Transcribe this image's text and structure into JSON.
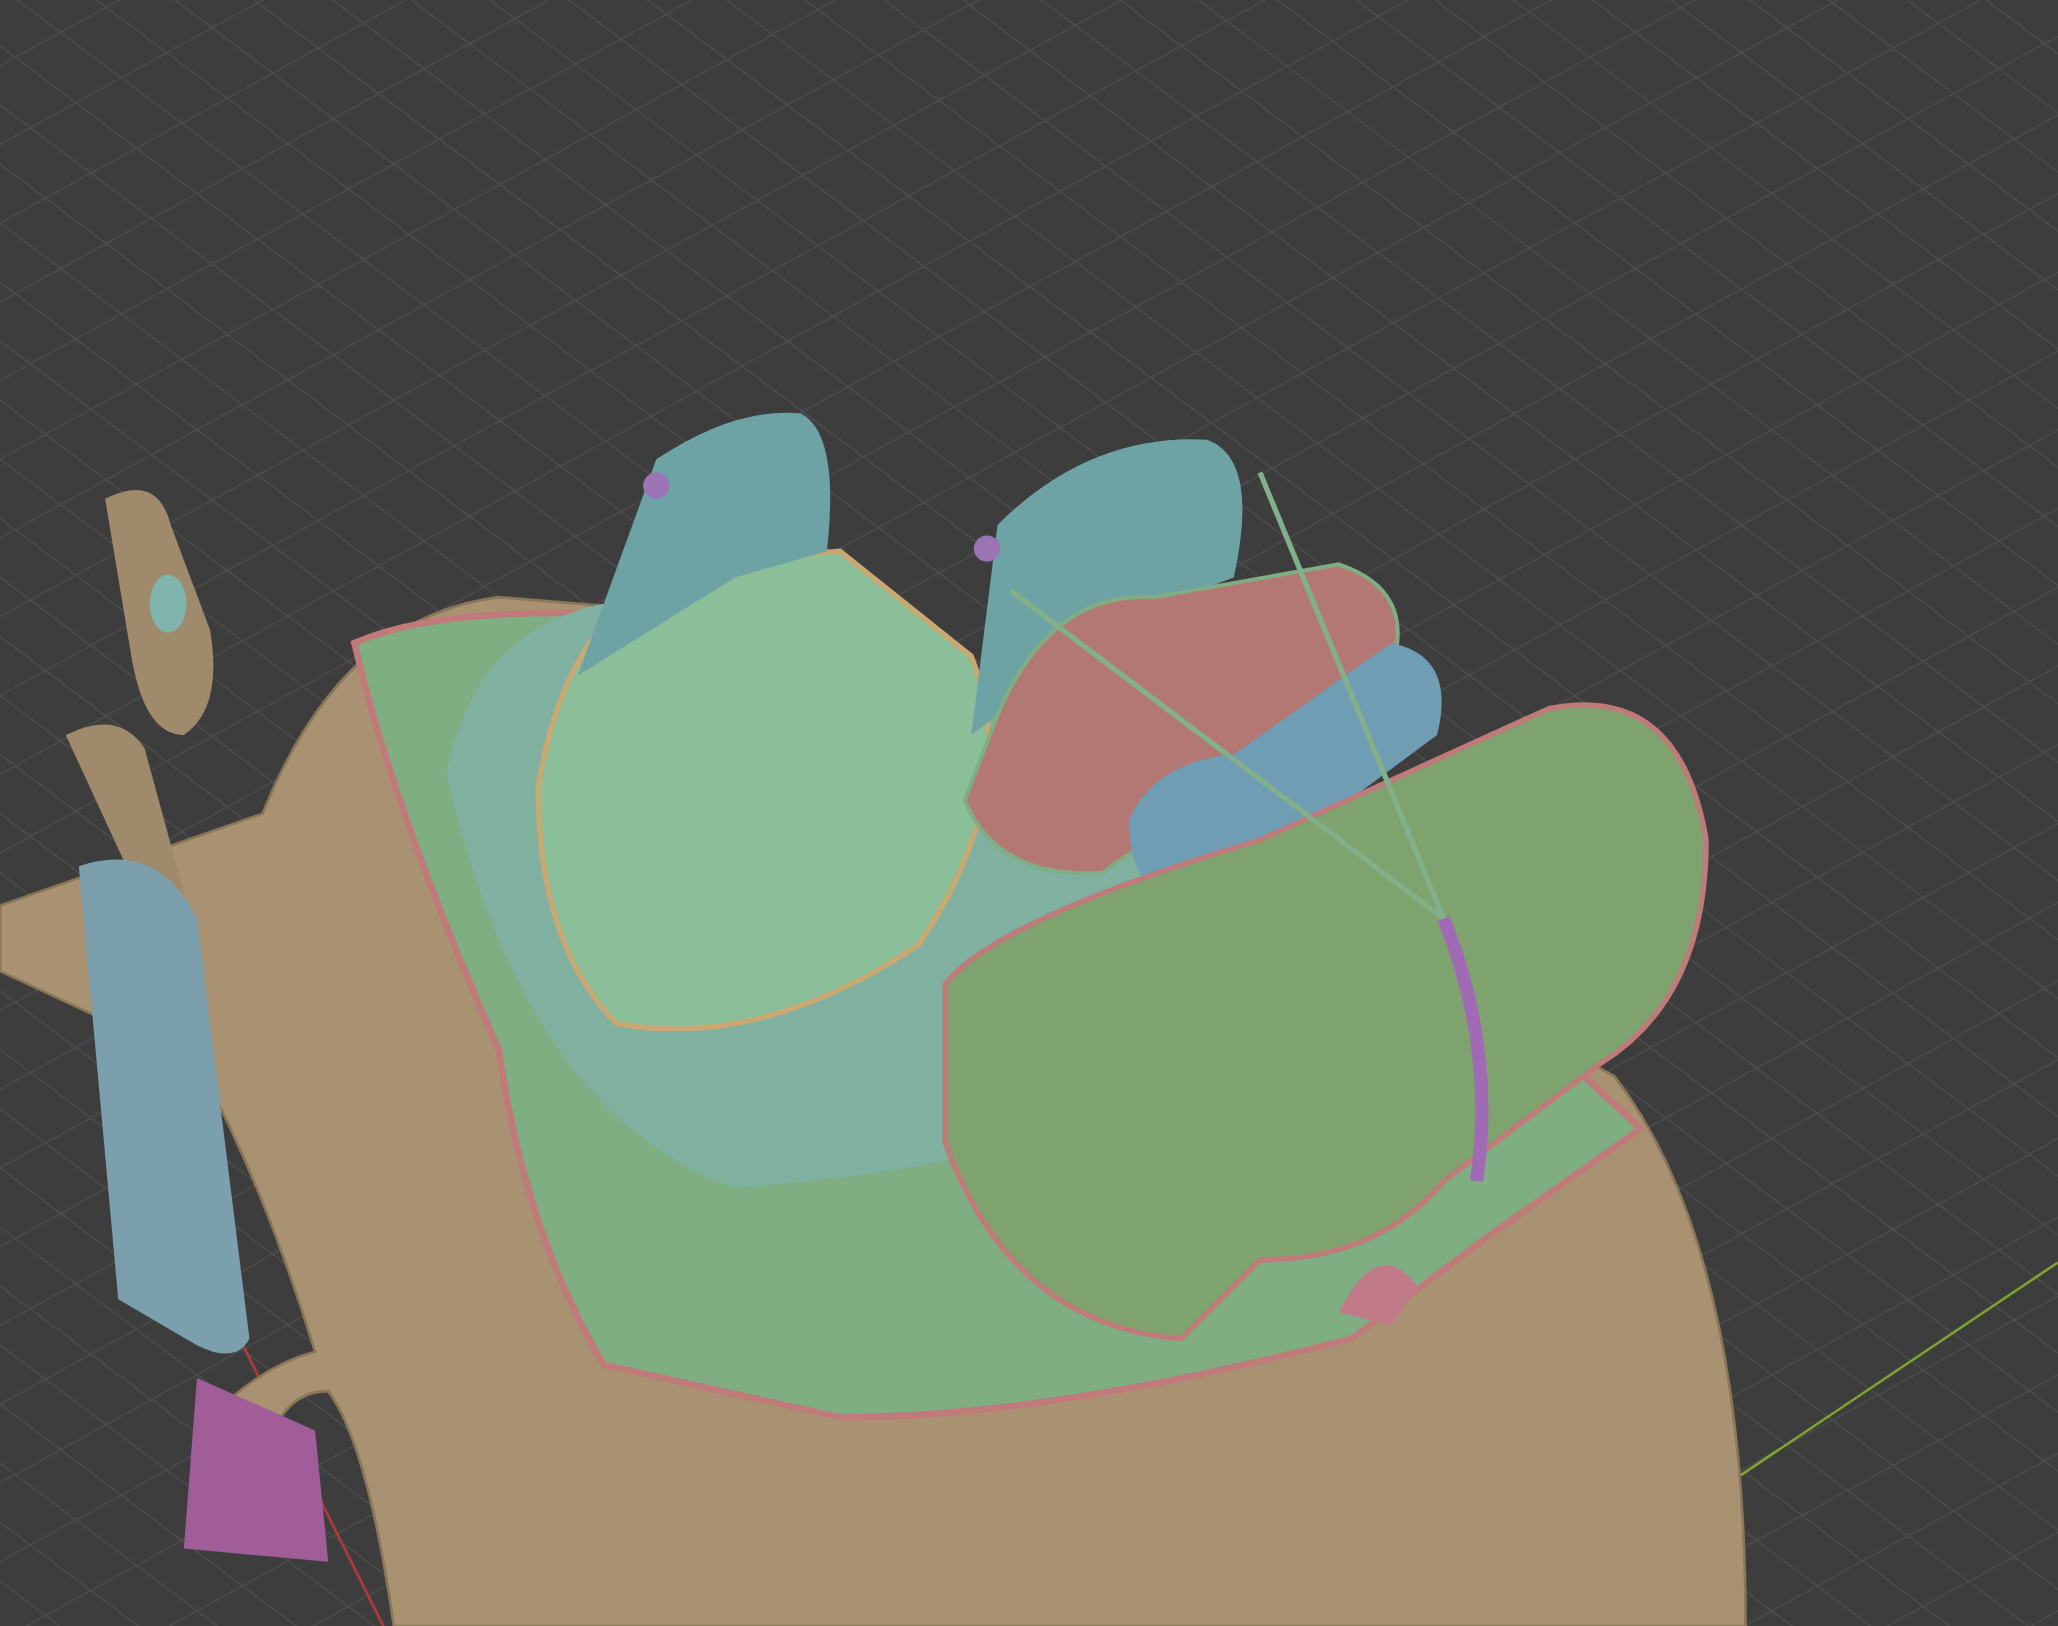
{
  "viewport": {
    "grid": true,
    "axes": [
      {
        "kind": "x",
        "color": "#b23a3a"
      },
      {
        "kind": "y",
        "color": "#7ea32e"
      }
    ]
  }
}
